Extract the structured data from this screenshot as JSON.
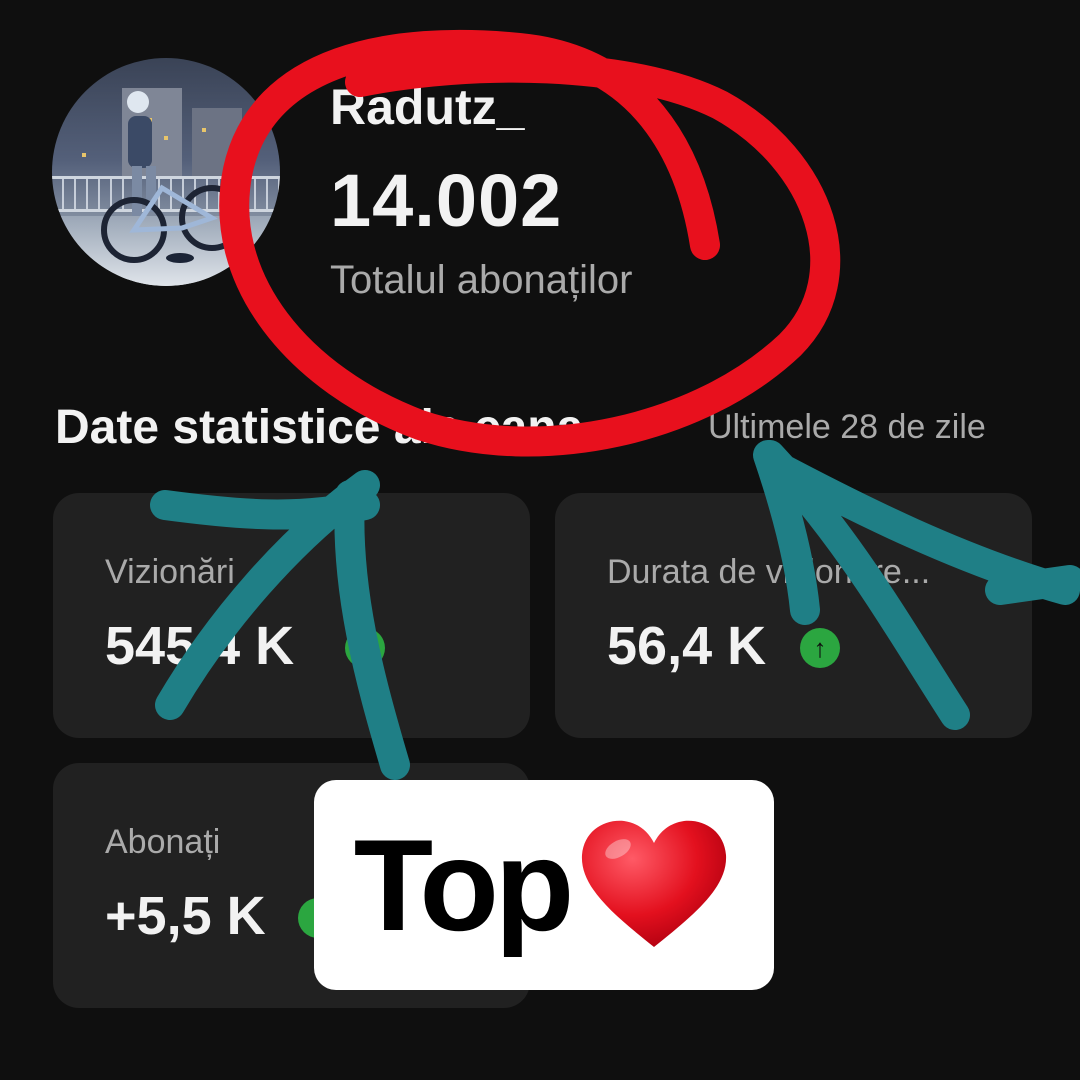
{
  "channel": {
    "name": "Radutz_",
    "subscriber_count": "14.002",
    "subscriber_label": "Totalul abonaților"
  },
  "stats": {
    "title": "Date statistice ale cana...",
    "period": "Ultimele 28 de zile",
    "cards": [
      {
        "label": "Vizionări",
        "value": "545,4 K",
        "trend": "up"
      },
      {
        "label": "Durata de vizionare...",
        "value": "56,4 K",
        "trend": "up"
      },
      {
        "label": "Abonați",
        "value": "+5,5 K",
        "trend": "up"
      }
    ]
  },
  "sticker": {
    "text": "Top",
    "emoji": "❤️"
  },
  "colors": {
    "background": "#0f0f0f",
    "card": "#212121",
    "trend_up": "#2ba640",
    "circle_annotation": "#e8101d",
    "arrow_annotation": "#1f7f86"
  },
  "icons": [
    "avatar",
    "arrow-up-icon",
    "heart-icon"
  ]
}
